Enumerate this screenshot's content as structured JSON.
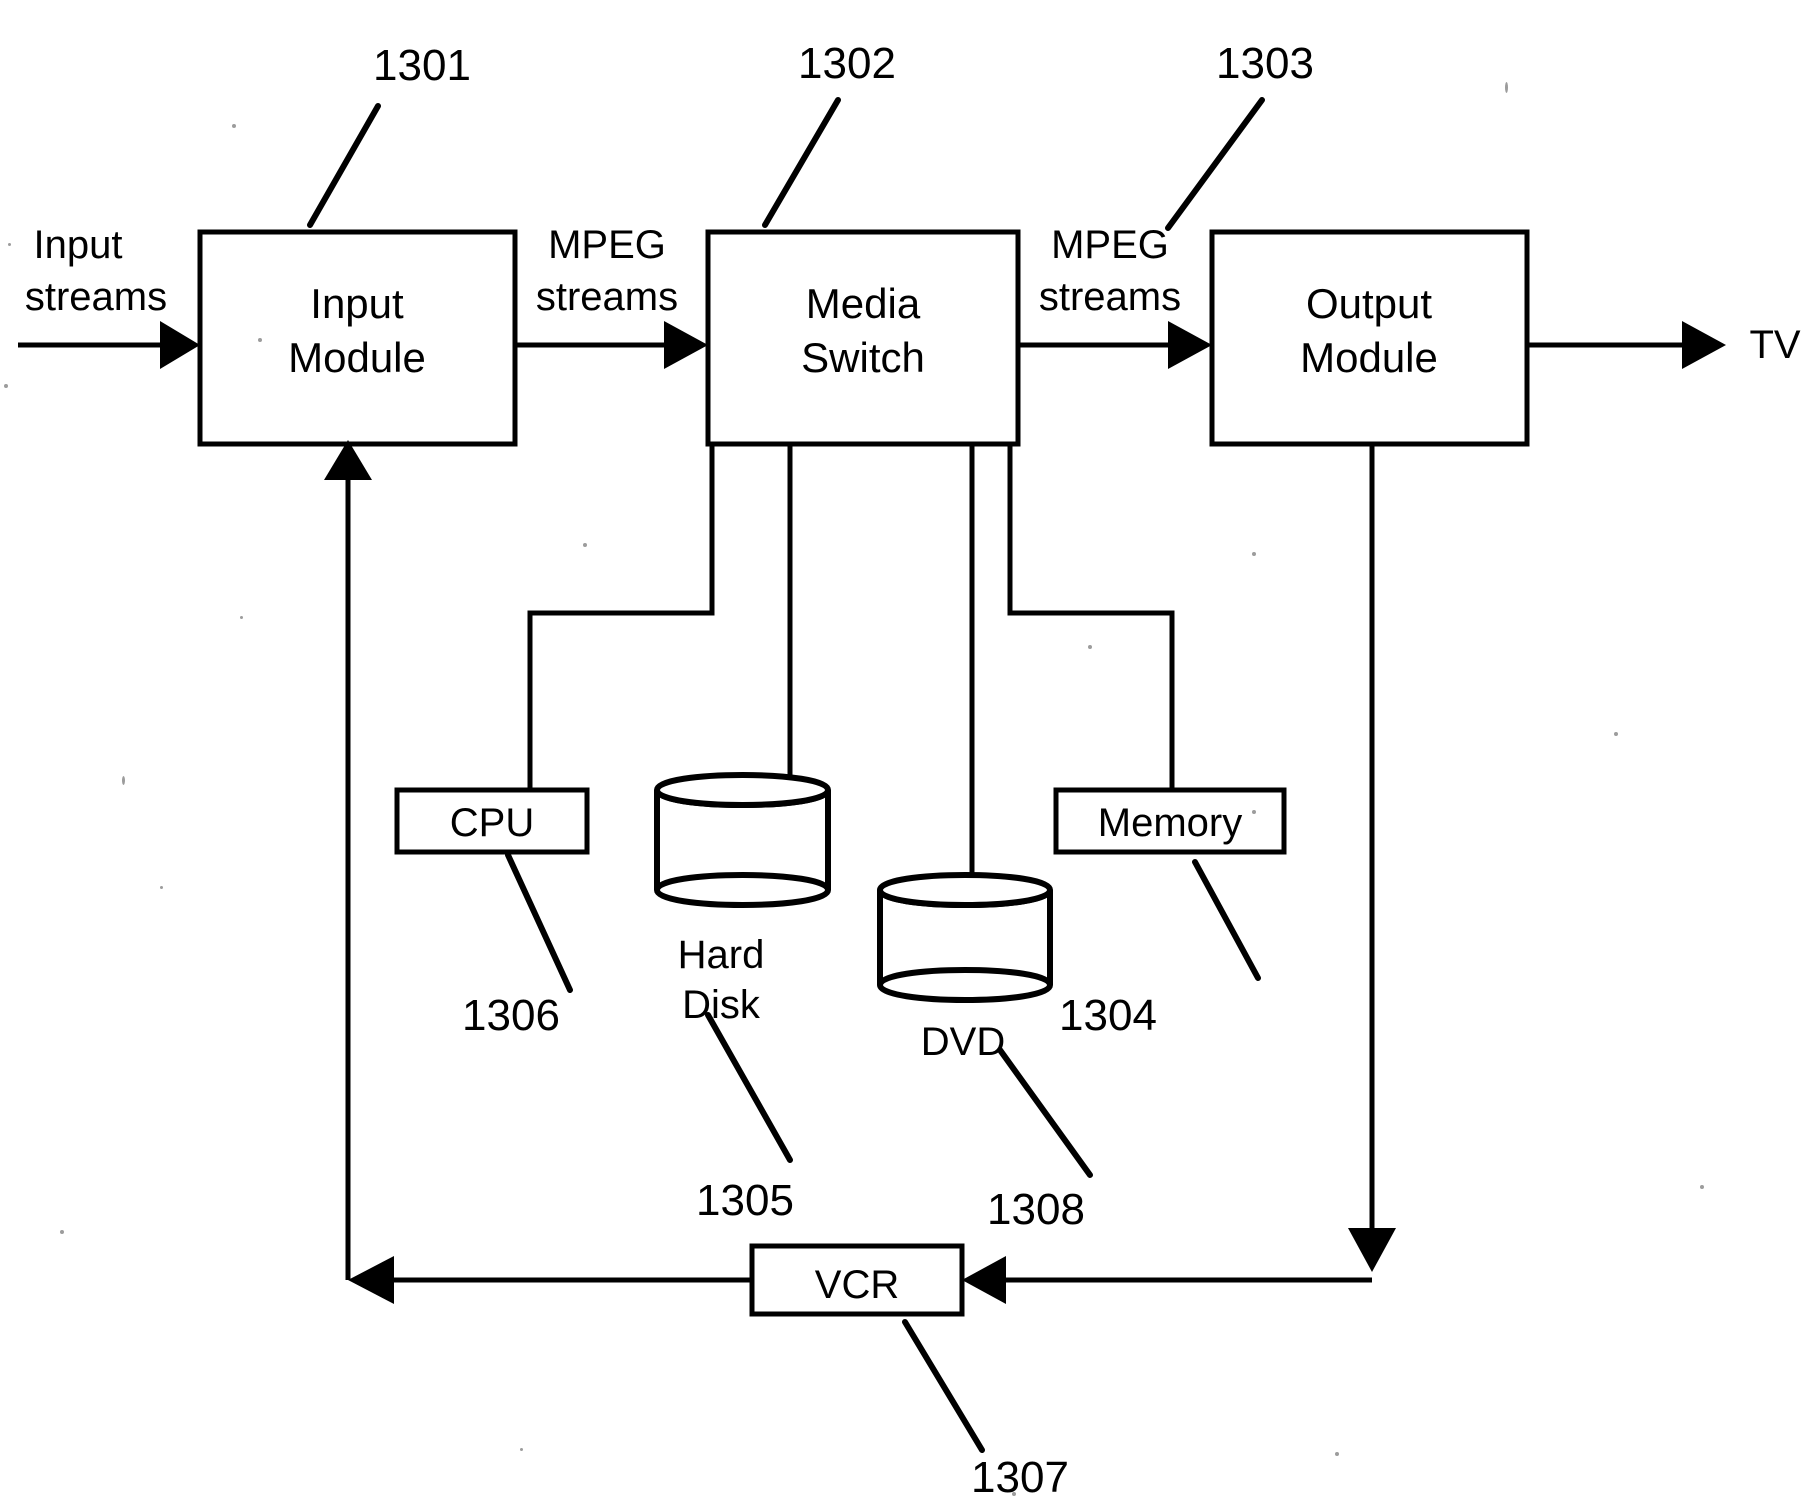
{
  "figure": {
    "type": "patent-block-diagram",
    "background_color": "#ffffff",
    "line_color": "#000000"
  },
  "blocks": [
    {
      "id": "input-module",
      "label_line1": "Input",
      "label_line2": "Module",
      "ref": "1301"
    },
    {
      "id": "media-switch",
      "label_line1": "Media",
      "label_line2": "Switch",
      "ref": "1302"
    },
    {
      "id": "output-module",
      "label_line1": "Output",
      "label_line2": "Module",
      "ref": "1303"
    }
  ],
  "components": [
    {
      "id": "cpu",
      "label": "CPU",
      "ref": "1306",
      "shape": "rect"
    },
    {
      "id": "hard-disk",
      "label_line1": "Hard",
      "label_line2": "Disk",
      "ref": "1305",
      "shape": "cylinder"
    },
    {
      "id": "dvd",
      "label": "DVD",
      "ref": "1308",
      "shape": "cylinder"
    },
    {
      "id": "memory",
      "label": "Memory",
      "ref": "1304",
      "shape": "rect"
    },
    {
      "id": "vcr",
      "label": "VCR",
      "ref": "1307",
      "shape": "rect"
    }
  ],
  "flow_labels": {
    "input_streams_line1": "Input",
    "input_streams_line2": "streams",
    "mpeg_streams_1_line1": "MPEG",
    "mpeg_streams_1_line2": "streams",
    "mpeg_streams_2_line1": "MPEG",
    "mpeg_streams_2_line2": "streams",
    "tv": "TV"
  },
  "reference_numbers": {
    "input_module": "1301",
    "media_switch": "1302",
    "output_module": "1303",
    "memory": "1304",
    "hard_disk": "1305",
    "cpu": "1306",
    "vcr": "1307",
    "dvd": "1308"
  },
  "chart_data": {
    "type": "diagram",
    "title": "",
    "nodes": [
      {
        "name": "Input Module",
        "ref": "1301"
      },
      {
        "name": "Media Switch",
        "ref": "1302"
      },
      {
        "name": "Output Module",
        "ref": "1303"
      },
      {
        "name": "Memory",
        "ref": "1304"
      },
      {
        "name": "Hard Disk",
        "ref": "1305"
      },
      {
        "name": "CPU",
        "ref": "1306"
      },
      {
        "name": "VCR",
        "ref": "1307"
      },
      {
        "name": "DVD",
        "ref": "1308"
      }
    ],
    "edges": [
      {
        "from": "Input streams",
        "to": "Input Module",
        "label": "Input streams",
        "directed": true
      },
      {
        "from": "Input Module",
        "to": "Media Switch",
        "label": "MPEG streams",
        "directed": true
      },
      {
        "from": "Media Switch",
        "to": "Output Module",
        "label": "MPEG streams",
        "directed": true
      },
      {
        "from": "Output Module",
        "to": "TV",
        "label": "TV",
        "directed": true
      },
      {
        "from": "Media Switch",
        "to": "CPU",
        "label": "",
        "directed": false
      },
      {
        "from": "Media Switch",
        "to": "Hard Disk",
        "label": "",
        "directed": false
      },
      {
        "from": "Media Switch",
        "to": "DVD",
        "label": "",
        "directed": false
      },
      {
        "from": "Media Switch",
        "to": "Memory",
        "label": "",
        "directed": false
      },
      {
        "from": "Output Module",
        "to": "VCR",
        "label": "",
        "directed": true
      },
      {
        "from": "VCR",
        "to": "Input Module",
        "label": "",
        "directed": true
      }
    ]
  }
}
